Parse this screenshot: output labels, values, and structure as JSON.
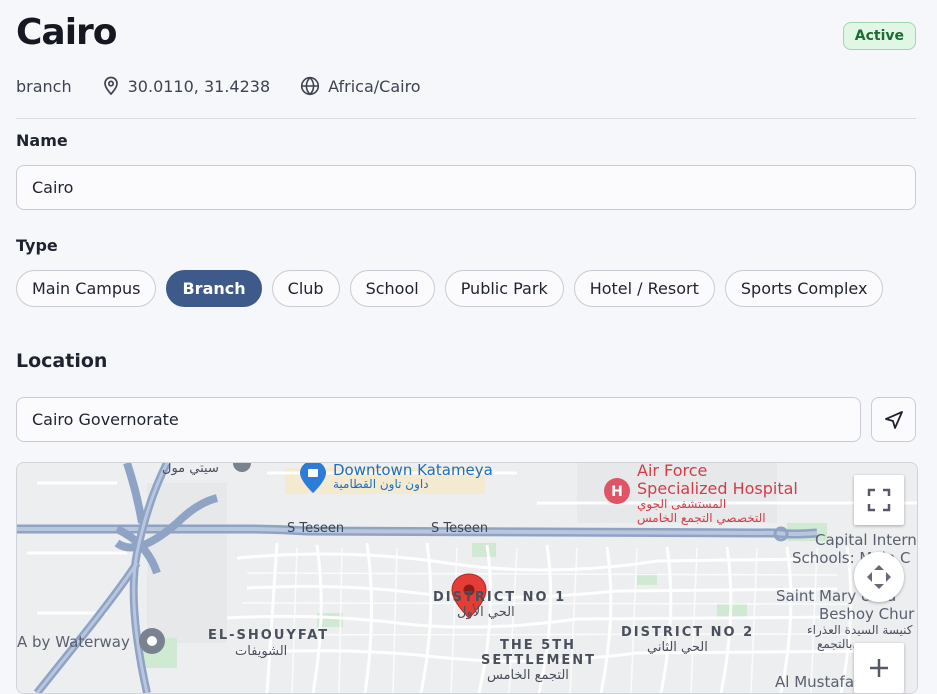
{
  "header": {
    "title": "Cairo",
    "status": "Active",
    "type": "branch",
    "coordinates": "30.0110, 31.4238",
    "timezone": "Africa/Cairo"
  },
  "form": {
    "name_label": "Name",
    "name_value": "Cairo",
    "type_label": "Type",
    "types": [
      "Main Campus",
      "Branch",
      "Club",
      "School",
      "Public Park",
      "Hotel / Resort",
      "Sports Complex"
    ],
    "selected_type": "Branch",
    "location_title": "Location",
    "location_value": "Cairo Governorate"
  },
  "map": {
    "labels": {
      "road_left": "S Teseen",
      "road_right": "S Teseen",
      "downtown": "Downtown Katameya",
      "downtown_ar": "داون تاون القطامية",
      "city_mall_ar": "سيتي مول",
      "airforce_1": "Air Force",
      "airforce_2": "Specialized Hospital",
      "airforce_ar_1": "المستشفى الجوي",
      "airforce_ar_2": "التخصصي التجمع الخامس",
      "capital_1": "Capital Intern",
      "capital_2": "Schools: Main C",
      "district1": "DISTRICT NO 1",
      "district1_ar": "الحي الأول",
      "district2": "DISTRICT NO 2",
      "district2_ar": "الحي الثاني",
      "fifth_1": "THE 5TH",
      "fifth_2": "SETTLEMENT",
      "fifth_ar": "التجمع الخامس",
      "shouyfat": "EL-SHOUYFAT",
      "shouyfat_ar": "الشويفات",
      "waterway": "A by Waterway",
      "saint_mary_1": "Saint Mary & Sa",
      "saint_mary_2": "Beshoy Chur",
      "saint_mary_ar_1": "كنيسة السيدة العذراء",
      "saint_mary_ar_2": "بالتجمع...",
      "mustafa": "Al Mustafa"
    }
  }
}
